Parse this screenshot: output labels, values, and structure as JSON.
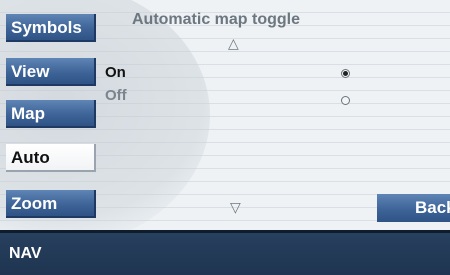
{
  "sidebar": {
    "items": [
      {
        "label": "Symbols",
        "active": false
      },
      {
        "label": "View",
        "active": false
      },
      {
        "label": "Map",
        "active": false
      },
      {
        "label": "Auto",
        "active": true
      },
      {
        "label": "Zoom",
        "active": false
      }
    ]
  },
  "main": {
    "title": "Automatic map toggle",
    "options": [
      {
        "label": "On",
        "selected": true
      },
      {
        "label": "Off",
        "selected": false
      }
    ],
    "scroll_up_icon": "triangle-up-outline",
    "scroll_down_icon": "triangle-down-outline"
  },
  "buttons": {
    "back_label": "Back"
  },
  "statusbar": {
    "mode": "NAV"
  },
  "colors": {
    "button_blue": "#3e6498",
    "status_bar": "#1f3551",
    "background": "#e6ebef"
  }
}
